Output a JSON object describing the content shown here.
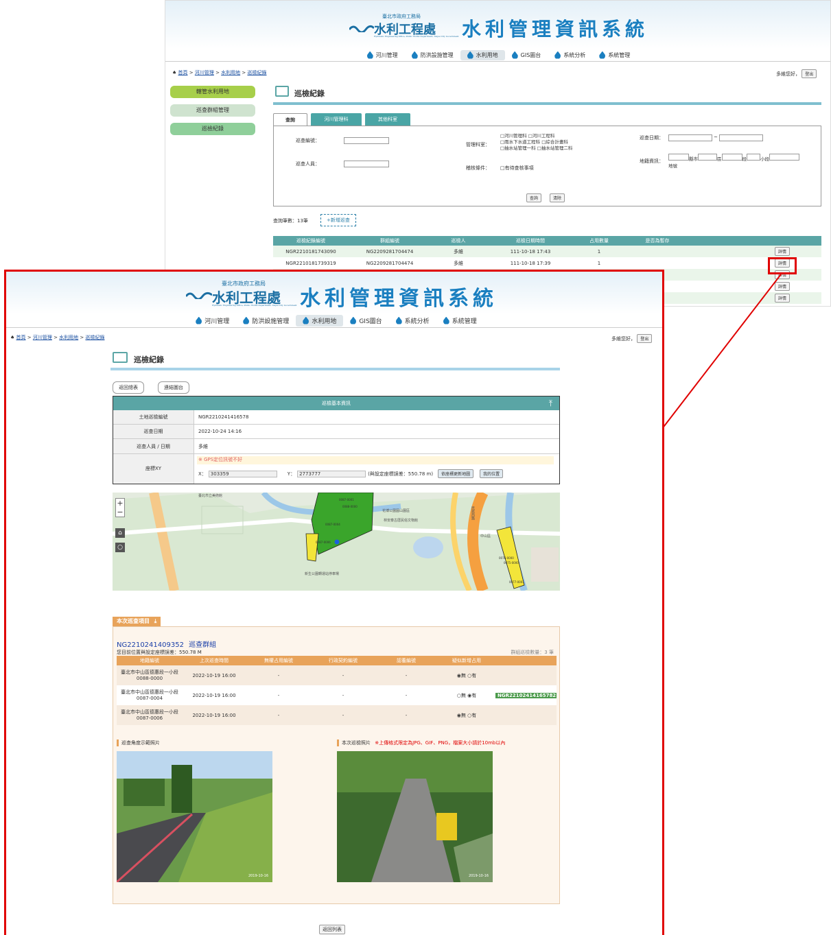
{
  "back": {
    "header": {
      "org_line": "臺北市政府工務局",
      "org_name": "水利工程處",
      "org_en": "Hydraulic Engineering Office, Public Works Department, Taipei City Government",
      "title": "水利管理資訊系統"
    },
    "nav": [
      "河川管理",
      "防洪設施管理",
      "水利用地",
      "GIS圖台",
      "系統分析",
      "系統管理"
    ],
    "breadcrumb": [
      "首頁",
      "河川管理",
      "水利用地",
      "巡檢紀錄"
    ],
    "greeting": "多維您好，",
    "logout": "登出",
    "sidebar": [
      "轄管水利用地",
      "巡查群組管理",
      "巡檢紀錄"
    ],
    "page_title": "巡檢紀錄",
    "tabs": [
      "查詢",
      "河川管理科",
      "其他科室"
    ],
    "form": {
      "no_label": "巡查編號：",
      "staff_label": "巡查人員：",
      "dept_label": "管理科室：",
      "depts": [
        "□河川管理科",
        "□河川工程科",
        "□雨水下水道工程科",
        "□綜合計畫科",
        "□抽水站管理一科",
        "□抽水站管理二科"
      ],
      "check_label": "稽核條件：",
      "check_opt": "□有待查核事項",
      "date_label": "巡查日期：",
      "date_sep": "~",
      "land_label": "地籍資訊：",
      "land_parts": [
        "縣市",
        "區",
        "段",
        "小段"
      ],
      "land_no": "地號",
      "query": "查詢",
      "clear": "清除"
    },
    "count": "查詢筆數：13筆",
    "add_btn": "+新增巡查",
    "table": {
      "headers": [
        "巡檢紀錄編號",
        "群組編號",
        "巡檢人",
        "巡檢日期時間",
        "占用數量",
        "是否為暫存"
      ],
      "rows": [
        [
          "NGR22101817430​90",
          "NG2209281704474",
          "多維",
          "111-10-18 17:43",
          "1"
        ],
        [
          "NGR22101817393​19",
          "NG2209281704474",
          "多維",
          "111-10-18 17:39",
          "1"
        ]
      ],
      "detail": "詳情"
    }
  },
  "front": {
    "header": {
      "org_line": "臺北市政府工務局",
      "org_name": "水利工程處",
      "org_en": "Hydraulic Engineering Office, Public Works Department, Taipei City Government",
      "title": "水利管理資訊系統"
    },
    "nav": [
      "河川管理",
      "防洪設施管理",
      "水利用地",
      "GIS圖台",
      "系統分析",
      "系統管理"
    ],
    "breadcrumb": [
      "首頁",
      "河川管理",
      "水利用地",
      "巡檢紀錄"
    ],
    "greeting": "多維您好，",
    "logout": "登出",
    "page_title": "巡檢紀錄",
    "btn_back_list": "返回總表",
    "btn_link_map": "連結圖台",
    "info_title": "巡檢基本資訊",
    "info": {
      "id_label": "土地巡檢編號",
      "id": "NGR2210241416578",
      "date_label": "巡查日期",
      "date": "2022-10-24 14:16",
      "staff_label": "巡查人員 / 日期",
      "staff": "多維",
      "xy_label": "座標XY",
      "gps_warn": "※ GPS定位訊號不好",
      "x_label": "X：",
      "x": "303359",
      "y_label": "Y：",
      "y": "2773777",
      "diff": "(與設定座標誤差：550.78 m)",
      "btn_update": "依座標更新地圖",
      "btn_mypos": "我的位置"
    },
    "map_labels": [
      "臺北市立美術館",
      "花博公園圓山園區",
      "林安泰古厝民俗文物館",
      "新生公園轉運站停車場",
      "中山區",
      "民族西路"
    ],
    "parcels": [
      "0087-0006",
      "0087-0004",
      "0088-0000",
      "0087-0001",
      "0076-0000",
      "0075-0000",
      "0077-0001"
    ],
    "items_title": "本次巡查項目",
    "group_id": "NG2210241409352",
    "group_label": "巡查群組",
    "diff_line": "您目前位置與設定座標誤差：550.78 M",
    "group_count": "群組巡檢數量：3 筆",
    "item_headers": [
      "地籍編號",
      "上次巡查時間",
      "無權占用編號",
      "行政契約編號",
      "認養編號",
      "疑似新增占用"
    ],
    "items": [
      {
        "land": "臺北市中山區德惠段一小段0088-0000",
        "time": "2022-10-19 16:00",
        "a": "-",
        "b": "-",
        "c": "-",
        "no": "無",
        "yes": "有",
        "tag": ""
      },
      {
        "land": "臺北市中山區德惠段一小段0087-0004",
        "time": "2022-10-19 16:00",
        "a": "-",
        "b": "-",
        "c": "-",
        "no": "無",
        "yes": "有",
        "tag": "NGR22102414165782"
      },
      {
        "land": "臺北市中山區德惠段一小段0087-0006",
        "time": "2022-10-19 16:00",
        "a": "-",
        "b": "-",
        "c": "-",
        "no": "無",
        "yes": "有",
        "tag": ""
      }
    ],
    "photo_demo_label": "巡查角度示範照片",
    "photo_this_label": "本次巡檢照片",
    "photo_note": "※上傳格式限定為JPG、GIF、PNG，檔案大小請於10mb以內",
    "photo_stamp1": "2019-10-16",
    "photo_stamp2": "2019-10-16",
    "back_list": "返回列表"
  },
  "colors": {
    "highlight": "#e00000",
    "teal": "#5aa5a5",
    "orange": "#e8a35a",
    "green_tag": "#4a9a4a"
  }
}
